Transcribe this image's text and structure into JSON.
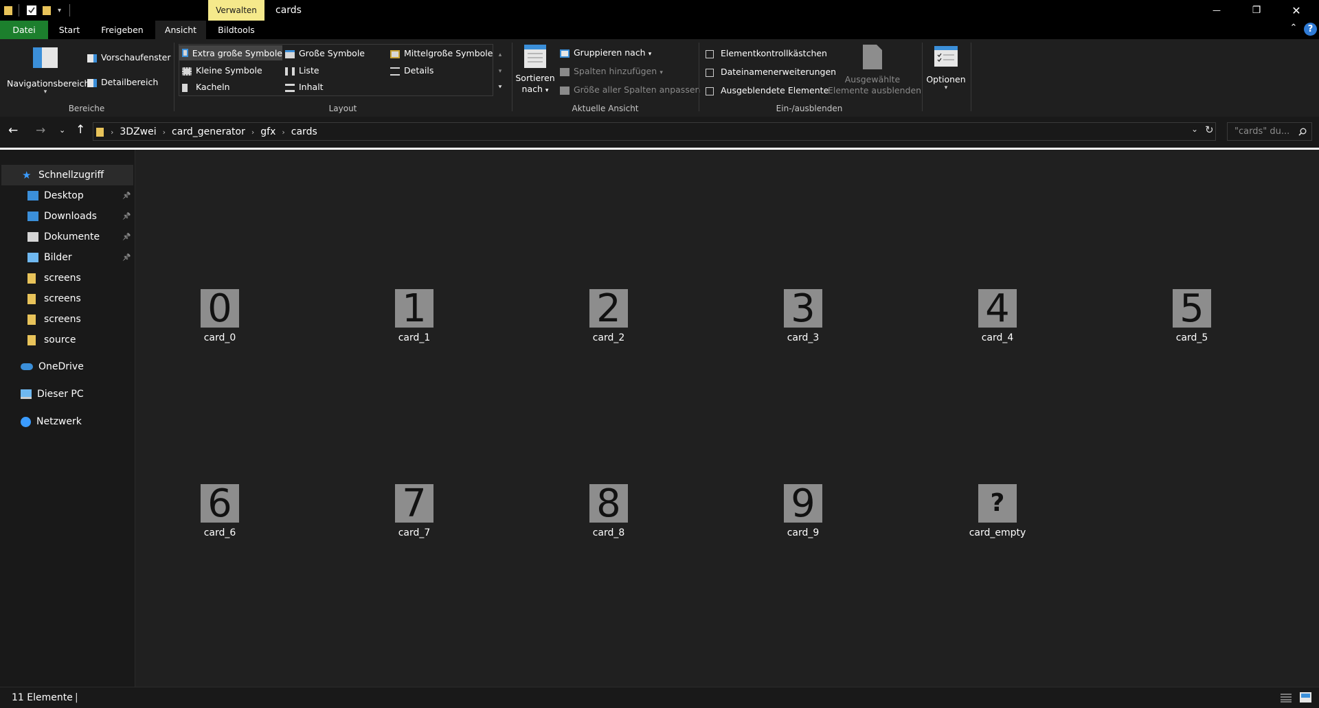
{
  "window": {
    "title": "cards",
    "contextual_tab": "Verwalten",
    "minimize_glyph": "—",
    "restore_glyph": "❐",
    "close_glyph": "✕"
  },
  "ribbon_tabs": [
    "Datei",
    "Start",
    "Freigeben",
    "Ansicht",
    "Bildtools"
  ],
  "active_tab": "Ansicht",
  "ribbon": {
    "panes": {
      "title": "Bereiche",
      "navigation_pane": "Navigationsbereich",
      "preview_pane": "Vorschaufenster",
      "details_pane": "Detailbereich"
    },
    "layout": {
      "title": "Layout",
      "options": [
        "Extra große Symbole",
        "Große Symbole",
        "Mittelgroße Symbole",
        "Kleine Symbole",
        "Liste",
        "Details",
        "Kacheln",
        "Inhalt"
      ],
      "selected": "Extra große Symbole"
    },
    "current_view": {
      "title": "Aktuelle Ansicht",
      "sort_line1": "Sortieren",
      "sort_line2": "nach",
      "group_by": "Gruppieren nach",
      "add_columns": "Spalten hinzufügen",
      "fit_columns": "Größe aller Spalten anpassen"
    },
    "show_hide": {
      "title": "Ein-/ausblenden",
      "item_checkboxes": "Elementkontrollkästchen",
      "file_extensions": "Dateinamenerweiterungen",
      "hidden_items": "Ausgeblendete Elemente",
      "hide_selected_line1": "Ausgewählte",
      "hide_selected_line2": "Elemente ausblenden"
    },
    "options": "Optionen"
  },
  "address": {
    "breadcrumb": [
      "3DZwei",
      "card_generator",
      "gfx",
      "cards"
    ],
    "search_placeholder": "\"cards\" du..."
  },
  "sidebar": {
    "quick_access": "Schnellzugriff",
    "items": [
      {
        "label": "Desktop",
        "icon": "desktop-icon",
        "pinned": true
      },
      {
        "label": "Downloads",
        "icon": "download-icon",
        "pinned": true
      },
      {
        "label": "Dokumente",
        "icon": "document-icon",
        "pinned": true
      },
      {
        "label": "Bilder",
        "icon": "pictures-icon",
        "pinned": true
      },
      {
        "label": "screens",
        "icon": "folder-icon",
        "pinned": false
      },
      {
        "label": "screens",
        "icon": "folder-icon",
        "pinned": false
      },
      {
        "label": "screens",
        "icon": "folder-icon",
        "pinned": false
      },
      {
        "label": "source",
        "icon": "folder-icon",
        "pinned": false
      }
    ],
    "onedrive": "OneDrive",
    "this_pc": "Dieser PC",
    "network": "Netzwerk"
  },
  "files": [
    {
      "name": "card_0",
      "glyph": "0"
    },
    {
      "name": "card_1",
      "glyph": "1"
    },
    {
      "name": "card_2",
      "glyph": "2"
    },
    {
      "name": "card_3",
      "glyph": "3"
    },
    {
      "name": "card_4",
      "glyph": "4"
    },
    {
      "name": "card_5",
      "glyph": "5"
    },
    {
      "name": "card_6",
      "glyph": "6"
    },
    {
      "name": "card_7",
      "glyph": "7"
    },
    {
      "name": "card_8",
      "glyph": "8"
    },
    {
      "name": "card_9",
      "glyph": "9"
    },
    {
      "name": "card_empty",
      "glyph": "?"
    }
  ],
  "status": {
    "item_count": "11 Elemente"
  },
  "colors": {
    "datei_tab": "#1c7f2d",
    "contextual_tab": "#f5e98b",
    "thumbnail": "#8d8d8d",
    "background": "#202020"
  }
}
